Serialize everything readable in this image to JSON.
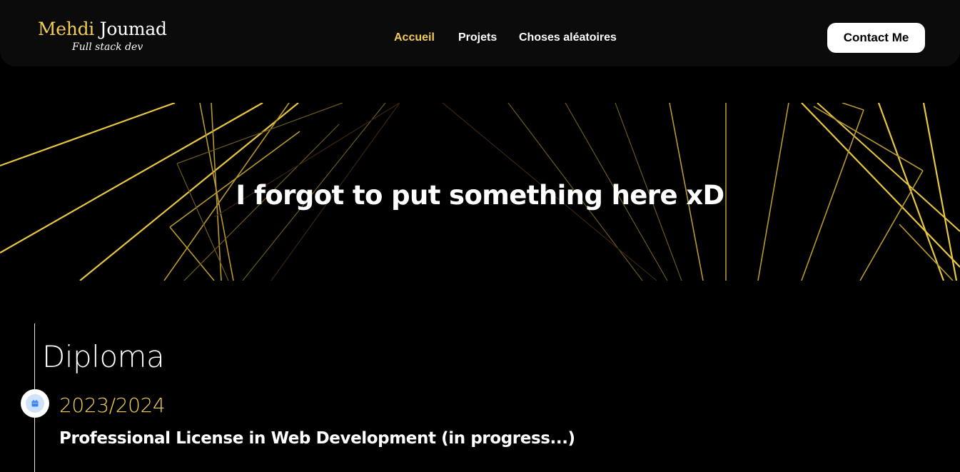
{
  "brand": {
    "first_name": "Mehdi",
    "last_name": "Joumad",
    "subtitle": "Full stack dev"
  },
  "nav": {
    "items": [
      {
        "label": "Accueil",
        "active": true
      },
      {
        "label": "Projets",
        "active": false
      },
      {
        "label": "Choses aléatoires",
        "active": false
      }
    ]
  },
  "header": {
    "contact_label": "Contact Me"
  },
  "hero": {
    "text": "I forgot to put something here xD"
  },
  "timeline": {
    "title": "Diploma",
    "entries": [
      {
        "date": "2023/2024",
        "title": "Professional License in Web Development (in progress...)",
        "icon": "calendar-icon"
      }
    ]
  },
  "colors": {
    "accent": "#f1cd55",
    "background": "#000000",
    "header_bg": "#0b0b0b",
    "timeline_icon_bg": "#cfe2fb",
    "timeline_icon": "#3b82f6"
  }
}
